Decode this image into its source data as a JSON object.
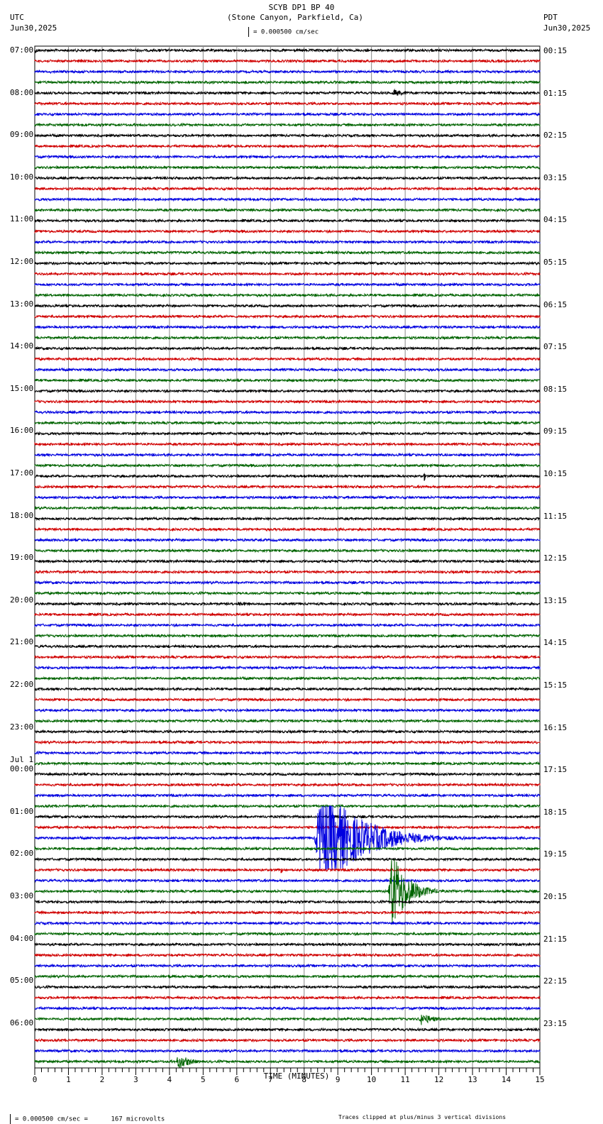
{
  "header": {
    "title": "SCYB DP1 BP 40",
    "subtitle": "(Stone Canyon, Parkfield, Ca)",
    "left_tz": "UTC",
    "left_date": "Jun30,2025",
    "right_tz": "PDT",
    "right_date": "Jun30,2025",
    "scale_text": "= 0.000500 cm/sec"
  },
  "footer": {
    "scale_text": "= 0.000500 cm/sec =      167 microvolts",
    "clip_note": "Traces clipped at plus/minus 3 vertical divisions"
  },
  "chart_data": {
    "type": "line",
    "title": "SCYB DP1 BP 40",
    "xlabel": "TIME (MINUTES)",
    "xlim": [
      0,
      15
    ],
    "x_ticks": [
      "0",
      "1",
      "2",
      "3",
      "4",
      "5",
      "6",
      "7",
      "8",
      "9",
      "10",
      "11",
      "12",
      "13",
      "14",
      "15"
    ],
    "traces_per_hour": 4,
    "trace_colors": [
      "#000000",
      "#d00000",
      "#0000e0",
      "#006400"
    ],
    "clip_divisions": 3,
    "left_labels": [
      "07:00",
      "08:00",
      "09:00",
      "10:00",
      "11:00",
      "12:00",
      "13:00",
      "14:00",
      "15:00",
      "16:00",
      "17:00",
      "18:00",
      "19:00",
      "20:00",
      "21:00",
      "22:00",
      "23:00",
      "00:00",
      "01:00",
      "02:00",
      "03:00",
      "04:00",
      "05:00",
      "06:00"
    ],
    "day_change_label": "Jul 1",
    "right_labels": [
      "00:15",
      "01:15",
      "02:15",
      "03:15",
      "04:15",
      "05:15",
      "06:15",
      "07:15",
      "08:15",
      "09:15",
      "10:15",
      "11:15",
      "12:15",
      "13:15",
      "14:15",
      "15:15",
      "16:15",
      "17:15",
      "18:15",
      "19:15",
      "20:15",
      "21:15",
      "22:15",
      "23:15"
    ],
    "events": [
      {
        "trace": 0,
        "start_min": 0.0,
        "dur_min": 0.4,
        "amp_div": 0.3
      },
      {
        "trace": 4,
        "start_min": 10.6,
        "dur_min": 1.5,
        "amp_div": 0.4
      },
      {
        "trace": 5,
        "start_min": 12.9,
        "dur_min": 0.5,
        "amp_div": 0.2
      },
      {
        "trace": 11,
        "start_min": 1.2,
        "dur_min": 0.7,
        "amp_div": 0.25
      },
      {
        "trace": 40,
        "start_min": 11.55,
        "dur_min": 0.15,
        "amp_div": 0.8
      },
      {
        "trace": 52,
        "start_min": 6.0,
        "dur_min": 1.0,
        "amp_div": 0.35
      },
      {
        "trace": 59,
        "start_min": 11.9,
        "dur_min": 0.7,
        "amp_div": 0.2
      },
      {
        "trace": 63,
        "start_min": 5.5,
        "dur_min": 0.4,
        "amp_div": 0.3
      },
      {
        "trace": 65,
        "start_min": 4.2,
        "dur_min": 0.8,
        "amp_div": 0.25
      },
      {
        "trace": 74,
        "start_min": 8.3,
        "dur_min": 4.7,
        "amp_div": 6.0
      },
      {
        "trace": 77,
        "start_min": 3.4,
        "dur_min": 0.3,
        "amp_div": 0.3
      },
      {
        "trace": 77,
        "start_min": 7.3,
        "dur_min": 0.3,
        "amp_div": 0.45
      },
      {
        "trace": 79,
        "start_min": 10.5,
        "dur_min": 1.8,
        "amp_div": 5.0
      },
      {
        "trace": 91,
        "start_min": 11.4,
        "dur_min": 1.6,
        "amp_div": 0.7
      },
      {
        "trace": 92,
        "start_min": 8.5,
        "dur_min": 0.2,
        "amp_div": 0.2
      },
      {
        "trace": 95,
        "start_min": 4.2,
        "dur_min": 1.4,
        "amp_div": 0.9
      }
    ]
  }
}
